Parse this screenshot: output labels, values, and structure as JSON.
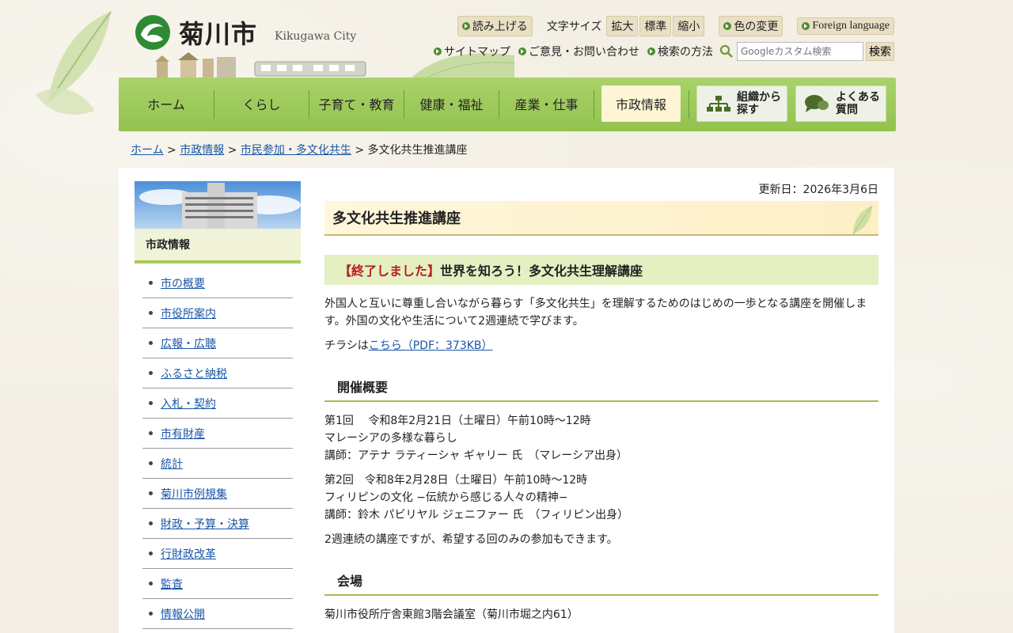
{
  "header": {
    "logo_text": "菊川市",
    "logo_en": "Kikugawa City"
  },
  "utility": {
    "read_aloud": "読み上げる",
    "text_size_label": "文字サイズ",
    "size_large": "拡大",
    "size_normal": "標準",
    "size_small": "縮小",
    "color_change": "色の変更",
    "foreign_language": "Foreign language",
    "sitemap": "サイトマップ",
    "feedback": "ご意見・お問い合わせ",
    "how_to_search": "検索の方法",
    "search_placeholder": "Googleカスタム検索",
    "search_button": "検索"
  },
  "nav": {
    "items": [
      "ホーム",
      "くらし",
      "子育て・教育",
      "健康・福祉",
      "産業・仕事",
      "市政情報"
    ],
    "org_search": [
      "組織から",
      "探す"
    ],
    "faq": [
      "よくある",
      "質問"
    ]
  },
  "breadcrumb": {
    "home": "ホーム",
    "level1": "市政情報",
    "level2": "市民参加・多文化共生",
    "current": "多文化共生推進講座",
    "sep": ">"
  },
  "sidebar": {
    "heading": "市政情報",
    "items": [
      "市の概要",
      "市役所案内",
      "広報・広聴",
      "ふるさと納税",
      "入札・契約",
      "市有財産",
      "統計",
      "菊川市例規集",
      "財政・予算・決算",
      "行財政改革",
      "監査",
      "情報公開"
    ]
  },
  "main": {
    "updated": "更新日：2026年3月6日",
    "title": "多文化共生推進講座",
    "section_ended": "【終了しました】",
    "section_title": "世界を知ろう！多文化共生理解講座",
    "intro": "外国人と互いに尊重し合いながら暮らす「多文化共生」を理解するためのはじめの一歩となる講座を開催します。外国の文化や生活について2週連続で学びます。",
    "flyer_prefix": "チラシは",
    "flyer_link": "こちら（PDF：373KB）",
    "overview_heading": "開催概要",
    "session1_line1": "第1回　 令和8年2月21日（土曜日）午前10時〜12時",
    "session1_line2": "マレーシアの多様な暮らし",
    "session1_line3": "講師：アテナ ラティーシャ ギャリー 氏　（マレーシア出身）",
    "session2_line1": "第2回　令和8年2月28日（土曜日）午前10時〜12時",
    "session2_line2": " フィリピンの文化 −伝統から感じる人々の精神−",
    "session2_line3": "講師：鈴木 パビリヤル ジェニファー 氏　（フィリピン出身）",
    "note": "2週連続の講座ですが、希望する回のみの参加もできます。",
    "venue_heading": "会場",
    "venue": "菊川市役所庁舎東館3階会議室（菊川市堀之内61）"
  },
  "colors": {
    "nav_green": "#9ccb5a",
    "link_blue": "#1a56a8",
    "ended_red": "#b52020",
    "section_bg": "#e4efc2"
  }
}
